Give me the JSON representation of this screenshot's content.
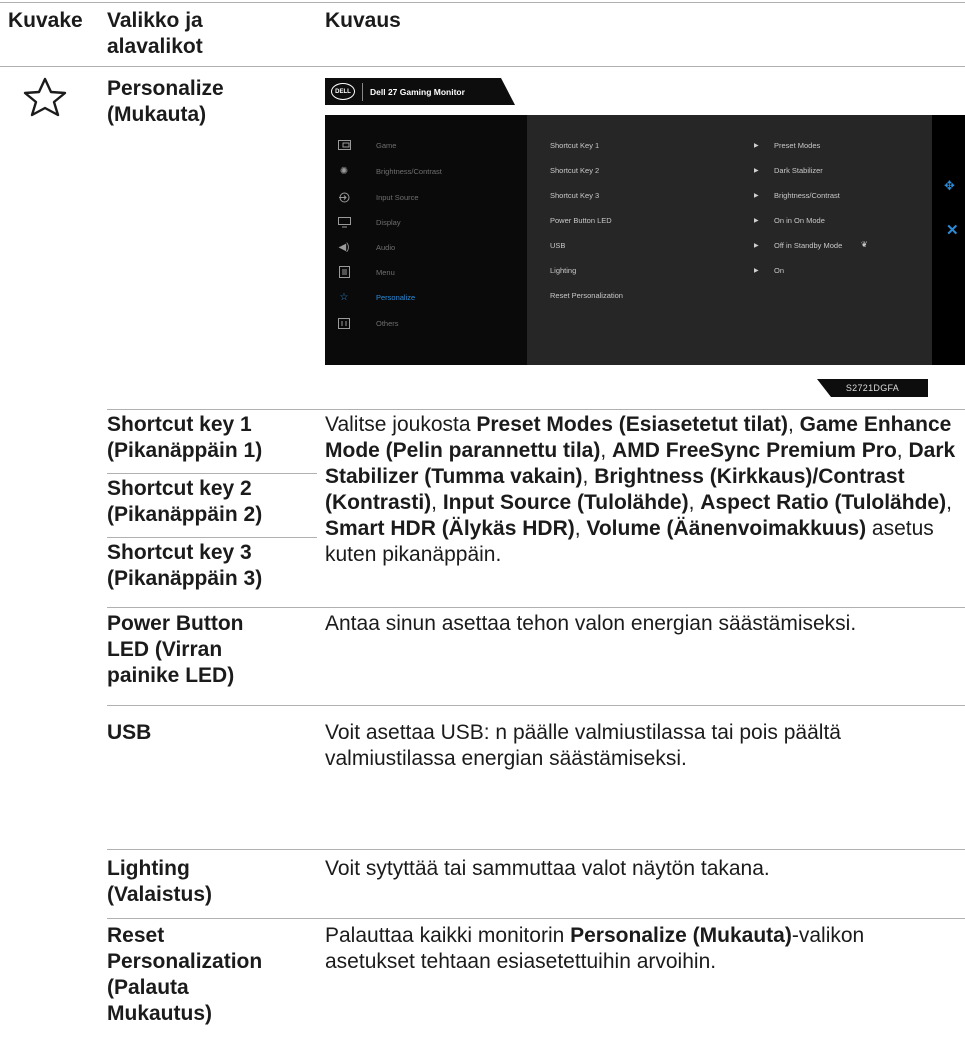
{
  "header": {
    "col_icon": "Kuvake",
    "col_menu": "Valikko ja\nalavalikot",
    "col_desc": "Kuvaus"
  },
  "personalize": {
    "title": "Personalize\n(Mukauta)",
    "icon": "star-outline-icon"
  },
  "osd": {
    "brand": "DELL",
    "title": "Dell 27 Gaming Monitor",
    "menu": [
      {
        "label": "Game",
        "icon": "game-icon"
      },
      {
        "label": "Brightness/Contrast",
        "icon": "sun-icon"
      },
      {
        "label": "Input Source",
        "icon": "input-icon"
      },
      {
        "label": "Display",
        "icon": "display-icon"
      },
      {
        "label": "Audio",
        "icon": "speaker-icon"
      },
      {
        "label": "Menu",
        "icon": "menu-icon"
      },
      {
        "label": "Personalize",
        "icon": "star-icon",
        "active": true
      },
      {
        "label": "Others",
        "icon": "others-icon"
      }
    ],
    "submenu": [
      {
        "label": "Shortcut Key 1",
        "value": "Preset Modes"
      },
      {
        "label": "Shortcut Key 2",
        "value": "Dark Stabilizer"
      },
      {
        "label": "Shortcut Key 3",
        "value": "Brightness/Contrast"
      },
      {
        "label": "Power Button LED",
        "value": "On in On Mode"
      },
      {
        "label": "USB",
        "value": "Off in Standby Mode"
      },
      {
        "label": "Lighting",
        "value": "On"
      },
      {
        "label": "Reset Personalization",
        "value": ""
      }
    ],
    "model": "S2721DGFA",
    "accent": "#2d8ad6"
  },
  "rows": {
    "shortcut1": "Shortcut key 1\n(Pikanäppäin 1)",
    "shortcut2": "Shortcut key 2\n(Pikanäppäin 2)",
    "shortcut3": "Shortcut key 3\n(Pikanäppäin 3)",
    "shortcut_desc": {
      "t1": "Valitse joukosta ",
      "b1": "Preset Modes (Esiasetetut tilat)",
      "t2": ", ",
      "b2": "Game Enhance Mode (Pelin parannettu tila)",
      "t3": ", ",
      "b3": "AMD FreeSync Premium Pro",
      "t4": ", ",
      "b4": "Dark Stabilizer (Tumma vakain)",
      "t5": ", ",
      "b5": "Brightness (Kirkkaus)/Contrast (Kontrasti)",
      "t6": ", ",
      "b6": "Input Source (Tulolähde)",
      "t7": ", ",
      "b7": "Aspect Ratio (Tulolähde)",
      "t8": ", ",
      "b8": "Smart HDR (Älykäs HDR)",
      "t9": ", ",
      "b9": "Volume (Äänenvoimakkuus)",
      "t10": " asetus kuten pikanäppäin."
    },
    "power_led": "Power Button\nLED (Virran\npainike LED)",
    "power_led_desc": "Antaa sinun asettaa tehon valon energian säästämiseksi.",
    "usb": "USB",
    "usb_desc": "Voit asettaa USB: n päälle valmiustilassa tai pois päältä valmiustilassa energian säästämiseksi.",
    "lighting": "Lighting\n(Valaistus)",
    "lighting_desc": "Voit sytyttää tai sammuttaa valot näytön takana.",
    "reset": "Reset\nPersonalization\n(Palauta\nMukautus)",
    "reset_desc": {
      "t1": "Palauttaa kaikki monitorin ",
      "b1": "Personalize (Mukauta)",
      "t2": "-valikon asetukset tehtaan esiasetettuihin arvoihin."
    }
  }
}
